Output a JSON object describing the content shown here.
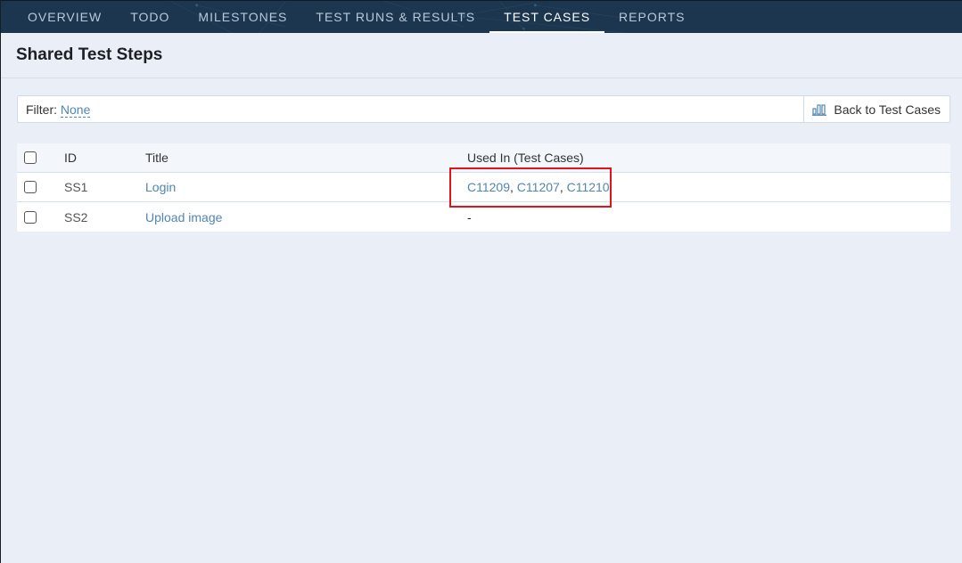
{
  "nav": {
    "tabs": [
      {
        "label": "OVERVIEW",
        "active": false
      },
      {
        "label": "TODO",
        "active": false
      },
      {
        "label": "MILESTONES",
        "active": false
      },
      {
        "label": "TEST RUNS & RESULTS",
        "active": false
      },
      {
        "label": "TEST CASES",
        "active": true
      },
      {
        "label": "REPORTS",
        "active": false
      }
    ]
  },
  "page": {
    "title": "Shared Test Steps"
  },
  "filter": {
    "label": "Filter:",
    "value": "None"
  },
  "toolbar": {
    "back_label": "Back to Test Cases",
    "back_icon": "bar-chart-icon"
  },
  "table": {
    "columns": [
      "ID",
      "Title",
      "Used In (Test Cases)"
    ],
    "rows": [
      {
        "id": "SS1",
        "title": "Login",
        "used_in": [
          "C11209",
          "C11207",
          "C11210"
        ],
        "used_in_sep": ", "
      },
      {
        "id": "SS2",
        "title": "Upload image",
        "used_in_text": "-"
      }
    ]
  },
  "colors": {
    "nav_bg": "#1c3650",
    "link": "#4f86b4",
    "highlight": "#e3131b",
    "page_bg": "#eaeff7"
  }
}
